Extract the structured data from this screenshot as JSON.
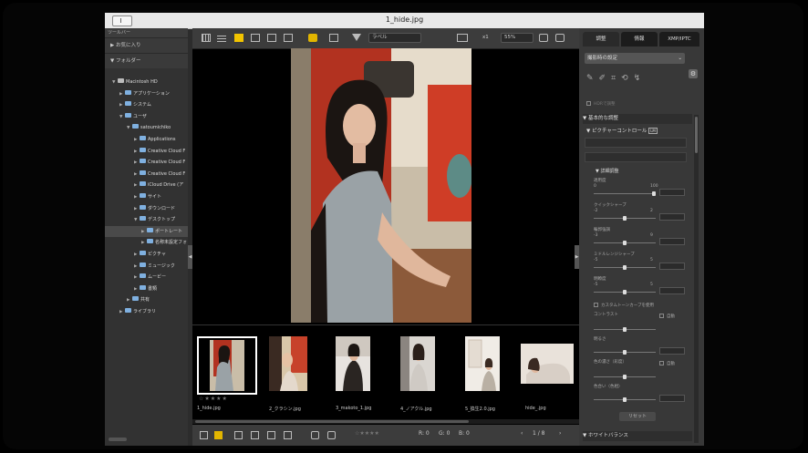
{
  "window": {
    "title": "1_hide.jpg"
  },
  "left_pane": {
    "toolbar_label": "ツールバー",
    "favorites": "お気に入り",
    "folders": "フォルダー",
    "tree": [
      {
        "label": "Macintosh HD",
        "depth": 0,
        "expanded": true,
        "drive": true
      },
      {
        "label": "アプリケーション",
        "depth": 1
      },
      {
        "label": "システム",
        "depth": 1
      },
      {
        "label": "ユーザ",
        "depth": 1,
        "expanded": true
      },
      {
        "label": "satoumichiko",
        "depth": 2,
        "expanded": true
      },
      {
        "label": "Applications",
        "depth": 3
      },
      {
        "label": "Creative Cloud F",
        "depth": 3
      },
      {
        "label": "Creative Cloud F",
        "depth": 3
      },
      {
        "label": "Creative Cloud F",
        "depth": 3
      },
      {
        "label": "iCloud Drive (ア",
        "depth": 3
      },
      {
        "label": "サイト",
        "depth": 3
      },
      {
        "label": "ダウンロード",
        "depth": 3
      },
      {
        "label": "デスクトップ",
        "depth": 3,
        "expanded": true
      },
      {
        "label": "ポートレート",
        "depth": 4,
        "selected": true
      },
      {
        "label": "名称未設定フォ",
        "depth": 4
      },
      {
        "label": "ピクチャ",
        "depth": 3
      },
      {
        "label": "ミュージック",
        "depth": 3
      },
      {
        "label": "ムービー",
        "depth": 3
      },
      {
        "label": "書類",
        "depth": 3
      },
      {
        "label": "共有",
        "depth": 2
      },
      {
        "label": "ライブラリ",
        "depth": 1
      }
    ]
  },
  "toolbar": {
    "label_filter": "ラベル",
    "zoom_fit": "x1",
    "zoom_percent": "55%"
  },
  "filmstrip": {
    "items": [
      {
        "label": "1_hide.jpg",
        "selected": true
      },
      {
        "label": "2_クラシン.jpg"
      },
      {
        "label": "3_makoto_1.jpg"
      },
      {
        "label": "4_ノアクル.jpg"
      },
      {
        "label": "5_換生2.0.jpg"
      },
      {
        "label": "hide_.jpg"
      }
    ],
    "rating": "☆★★★★"
  },
  "bottom_bar": {
    "r": "R: 0",
    "g": "G: 0",
    "b": "B: 0",
    "page": "1 / 8"
  },
  "right_pane": {
    "tabs": [
      "調整",
      "情報",
      "XMP/IPTC"
    ],
    "preset": "撮影時の設定",
    "hdr": "HDRで調整",
    "section_basic": "基本的な調整",
    "picture_control": "ピクチャーコントロール",
    "detail": "詳細調整",
    "sliders": [
      {
        "label": "適用度",
        "min": "0",
        "max": "100",
        "level": 1.0
      },
      {
        "label": "クイックシャープ",
        "min": "-2",
        "max": "2",
        "level": 0.5
      },
      {
        "label": "輪郭強調",
        "min": "-3",
        "max": "9",
        "level": 0.5
      },
      {
        "label": "ミドルレンジシャープ",
        "min": "-5",
        "max": "5",
        "level": 0.5
      },
      {
        "label": "明瞭度",
        "min": "-5",
        "max": "5",
        "level": 0.5
      }
    ],
    "custom_curve": "カスタムトーンカーブを使用",
    "contrast": "コントラスト",
    "brightness": "明るさ",
    "saturation": "色の濃さ（彩度）",
    "hue": "色合い（色相）",
    "auto": "自動",
    "reset": "リセット",
    "white_balance": "ホワイトバランス"
  },
  "colors": {
    "accent": "#f2c400",
    "folder": "#7fb0e0"
  }
}
